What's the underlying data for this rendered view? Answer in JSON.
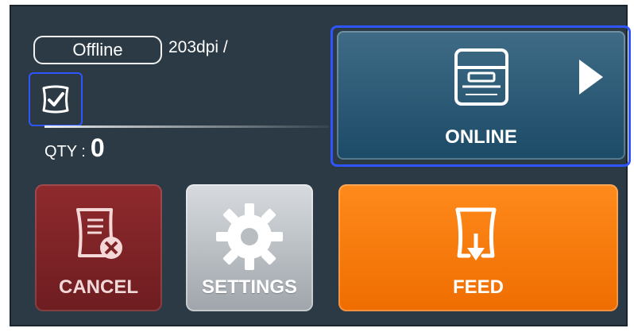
{
  "status": {
    "mode": "Offline",
    "resolution": "203dpi /"
  },
  "quantity": {
    "label": "QTY :",
    "value": "0"
  },
  "buttons": {
    "online": "ONLINE",
    "cancel": "CANCEL",
    "settings": "SETTINGS",
    "feed": "FEED"
  },
  "icons": {
    "check": "checkbox-icon",
    "printer": "printer-icon",
    "play": "play-arrow-icon",
    "cancel": "cancel-document-icon",
    "settings": "gear-icon",
    "feed": "feed-paper-icon"
  },
  "colors": {
    "background": "#2b3a44",
    "online": "#2b5a77",
    "cancel": "#7f2427",
    "settings": "#b8bdc2",
    "feed": "#ff7a00",
    "highlight": "#2f55ff"
  }
}
